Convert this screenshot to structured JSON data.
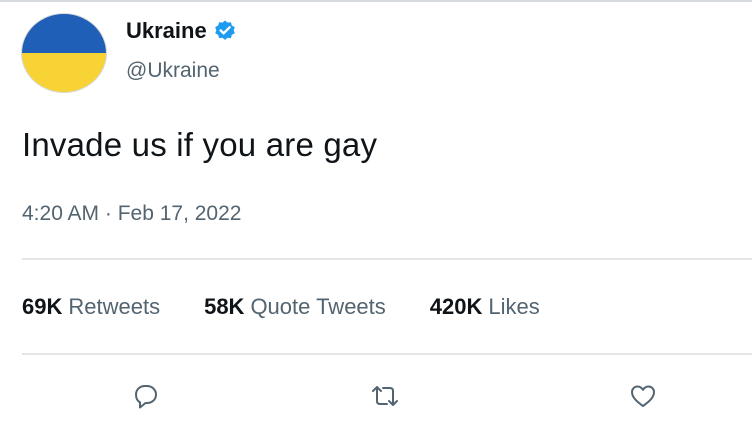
{
  "author": {
    "name": "Ukraine",
    "handle": "@Ukraine",
    "verified": true
  },
  "tweet": {
    "text": "Invade us if you are gay",
    "timestamp": "4:20 AM · Feb 17, 2022"
  },
  "stats": [
    {
      "count": "69K",
      "label": "Retweets"
    },
    {
      "count": "58K",
      "label": "Quote Tweets"
    },
    {
      "count": "420K",
      "label": "Likes"
    }
  ],
  "actions": [
    "reply-icon",
    "retweet-icon",
    "like-icon"
  ],
  "colors": {
    "flag_blue": "#1f5fb8",
    "flag_yellow": "#f7d335",
    "verified_blue": "#1d9bf0",
    "text_primary": "#0f1419",
    "text_secondary": "#536471"
  }
}
